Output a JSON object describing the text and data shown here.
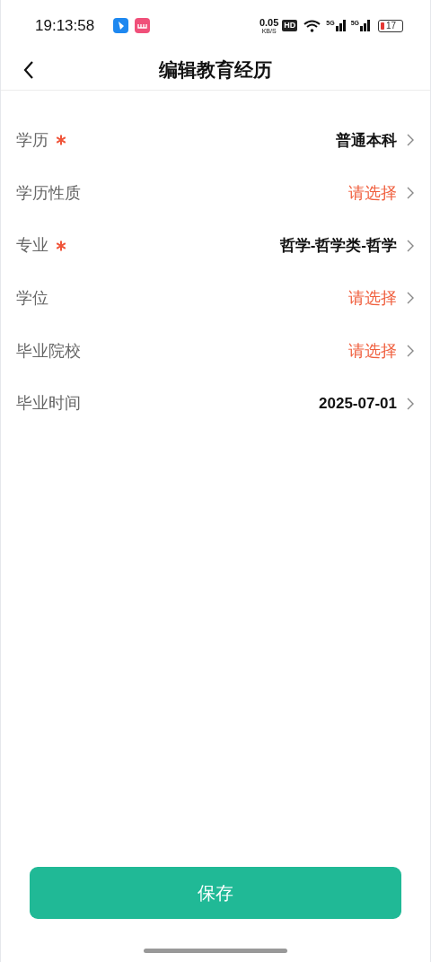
{
  "status_bar": {
    "time": "19:13:58",
    "net_speed": "0.05",
    "net_unit": "KB/S",
    "hd": "HD",
    "signals": [
      "5G",
      "5G"
    ],
    "battery": "17"
  },
  "nav": {
    "title": "编辑教育经历"
  },
  "fields": [
    {
      "label": "学历",
      "required": true,
      "value": "普通本科"
    },
    {
      "label": "学历性质",
      "required": false,
      "placeholder": "请选择"
    },
    {
      "label": "专业",
      "required": true,
      "value": "哲学-哲学类-哲学"
    },
    {
      "label": "学位",
      "required": false,
      "placeholder": "请选择"
    },
    {
      "label": "毕业院校",
      "required": false,
      "placeholder": "请选择"
    },
    {
      "label": "毕业时间",
      "required": false,
      "value": "2025-07-01"
    }
  ],
  "save_button": {
    "label": "保存"
  }
}
